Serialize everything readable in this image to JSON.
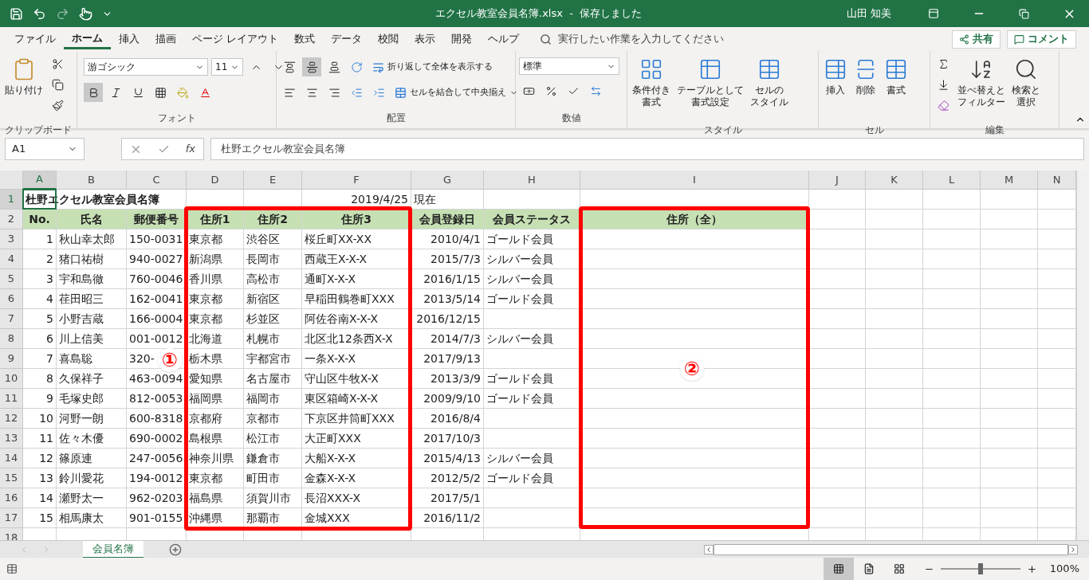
{
  "window": {
    "title": "エクセル教室会員名簿.xlsx  -  保存しました",
    "user": "山田 知美"
  },
  "tabs": [
    {
      "label": "ファイル",
      "selected": false
    },
    {
      "label": "ホーム",
      "selected": true
    },
    {
      "label": "挿入",
      "selected": false
    },
    {
      "label": "描画",
      "selected": false
    },
    {
      "label": "ページ レイアウト",
      "selected": false
    },
    {
      "label": "数式",
      "selected": false
    },
    {
      "label": "データ",
      "selected": false
    },
    {
      "label": "校閲",
      "selected": false
    },
    {
      "label": "表示",
      "selected": false
    },
    {
      "label": "開発",
      "selected": false
    },
    {
      "label": "ヘルプ",
      "selected": false
    }
  ],
  "tell_me": {
    "placeholder": "実行したい作業を入力してください"
  },
  "share_button": "共有",
  "comment_button": "コメント",
  "ribbon": {
    "clipboard": {
      "label": "クリップボード",
      "paste": "貼り付け"
    },
    "font": {
      "label": "フォント",
      "font_name": "游ゴシック",
      "font_size": "11",
      "bold": true
    },
    "alignment": {
      "label": "配置",
      "wrap": "折り返して全体を表示する",
      "merge": "セルを結合して中央揃え",
      "middle_align": true
    },
    "number": {
      "label": "数値",
      "format": "標準"
    },
    "styles": {
      "label": "スタイル",
      "buttons": [
        {
          "lines": [
            "条件付き",
            "書式"
          ]
        },
        {
          "lines": [
            "テーブルとして",
            "書式設定"
          ]
        },
        {
          "lines": [
            "セルの",
            "スタイル"
          ]
        }
      ]
    },
    "cells": {
      "label": "セル",
      "buttons": [
        "挿入",
        "削除",
        "書式"
      ]
    },
    "editing": {
      "label": "編集",
      "buttons": [
        {
          "lines": [
            "並べ替えと",
            "フィルター"
          ]
        },
        {
          "lines": [
            "検索と",
            "選択"
          ]
        }
      ]
    }
  },
  "formula_bar": {
    "name_box": "A1",
    "fx": "fx",
    "formula": "杜野エクセル教室会員名簿"
  },
  "sheet": {
    "columns": [
      {
        "label": "A",
        "selected": true
      },
      {
        "label": "B",
        "selected": false
      },
      {
        "label": "C",
        "selected": false
      },
      {
        "label": "D",
        "selected": false
      },
      {
        "label": "E",
        "selected": false
      },
      {
        "label": "F",
        "selected": false
      },
      {
        "label": "G",
        "selected": false
      },
      {
        "label": "H",
        "selected": false
      },
      {
        "label": "I",
        "selected": false
      },
      {
        "label": "J",
        "selected": false
      },
      {
        "label": "K",
        "selected": false
      },
      {
        "label": "L",
        "selected": false
      },
      {
        "label": "M",
        "selected": false
      },
      {
        "label": "N",
        "selected": false
      }
    ],
    "rows": [
      {
        "number": "1",
        "selected": true,
        "kind": "title",
        "cells": [
          {
            "text": "杜野エクセル教室会員名簿"
          },
          null,
          null,
          null,
          null,
          {
            "text": "2019/4/25",
            "right": true
          },
          {
            "text": "現在"
          },
          null,
          null
        ]
      },
      {
        "number": "2",
        "selected": false,
        "kind": "header",
        "cells": [
          {
            "text": "No."
          },
          {
            "text": "氏名"
          },
          {
            "text": "郵便番号"
          },
          {
            "text": "住所1"
          },
          {
            "text": "住所2"
          },
          {
            "text": "住所3"
          },
          {
            "text": "会員登録日"
          },
          {
            "text": "会員ステータス"
          },
          {
            "text": "住所（全）"
          }
        ]
      },
      {
        "number": "3",
        "selected": false,
        "kind": "data",
        "cells": [
          {
            "text": "1",
            "right": true
          },
          {
            "text": "秋山幸太郎"
          },
          {
            "text": "150-0031"
          },
          {
            "text": "東京都"
          },
          {
            "text": "渋谷区"
          },
          {
            "text": "桜丘町XX-XX"
          },
          {
            "text": "2010/4/1",
            "right": true
          },
          {
            "text": "ゴールド会員"
          },
          null
        ]
      },
      {
        "number": "4",
        "selected": false,
        "kind": "data",
        "cells": [
          {
            "text": "2",
            "right": true
          },
          {
            "text": "猪口祐樹"
          },
          {
            "text": "940-0027"
          },
          {
            "text": "新潟県"
          },
          {
            "text": "長岡市"
          },
          {
            "text": "西蔵王X-X-X"
          },
          {
            "text": "2015/7/3",
            "right": true
          },
          {
            "text": "シルバー会員"
          },
          null
        ]
      },
      {
        "number": "5",
        "selected": false,
        "kind": "data",
        "cells": [
          {
            "text": "3",
            "right": true
          },
          {
            "text": "宇和島徹"
          },
          {
            "text": "760-0046"
          },
          {
            "text": "香川県"
          },
          {
            "text": "高松市"
          },
          {
            "text": "通町X-X-X"
          },
          {
            "text": "2016/1/15",
            "right": true
          },
          {
            "text": "シルバー会員"
          },
          null
        ]
      },
      {
        "number": "6",
        "selected": false,
        "kind": "data",
        "cells": [
          {
            "text": "4",
            "right": true
          },
          {
            "text": "荏田昭三"
          },
          {
            "text": "162-0041"
          },
          {
            "text": "東京都"
          },
          {
            "text": "新宿区"
          },
          {
            "text": "早稲田鶴巻町XXX"
          },
          {
            "text": "2013/5/14",
            "right": true
          },
          {
            "text": "ゴールド会員"
          },
          null
        ]
      },
      {
        "number": "7",
        "selected": false,
        "kind": "data",
        "cells": [
          {
            "text": "5",
            "right": true
          },
          {
            "text": "小野吉蔵"
          },
          {
            "text": "166-0004"
          },
          {
            "text": "東京都"
          },
          {
            "text": "杉並区"
          },
          {
            "text": "阿佐谷南X-X-X"
          },
          {
            "text": "2016/12/15",
            "right": true
          },
          null,
          null
        ]
      },
      {
        "number": "8",
        "selected": false,
        "kind": "data",
        "cells": [
          {
            "text": "6",
            "right": true
          },
          {
            "text": "川上信美"
          },
          {
            "text": "001-0012"
          },
          {
            "text": "北海道"
          },
          {
            "text": "札幌市"
          },
          {
            "text": "北区北12条西X-X"
          },
          {
            "text": "2014/7/3",
            "right": true
          },
          {
            "text": "シルバー会員"
          },
          null
        ]
      },
      {
        "number": "9",
        "selected": false,
        "kind": "data",
        "cells": [
          {
            "text": "7",
            "right": true
          },
          {
            "text": "喜島聡"
          },
          {
            "text": "320-"
          },
          {
            "text": "栃木県"
          },
          {
            "text": "宇都宮市"
          },
          {
            "text": "一条X-X-X"
          },
          {
            "text": "2017/9/13",
            "right": true
          },
          null,
          null
        ]
      },
      {
        "number": "10",
        "selected": false,
        "kind": "data",
        "cells": [
          {
            "text": "8",
            "right": true
          },
          {
            "text": "久保祥子"
          },
          {
            "text": "463-0094"
          },
          {
            "text": "愛知県"
          },
          {
            "text": "名古屋市"
          },
          {
            "text": "守山区牛牧X-X"
          },
          {
            "text": "2013/3/9",
            "right": true
          },
          {
            "text": "ゴールド会員"
          },
          null
        ]
      },
      {
        "number": "11",
        "selected": false,
        "kind": "data",
        "cells": [
          {
            "text": "9",
            "right": true
          },
          {
            "text": "毛塚史郎"
          },
          {
            "text": "812-0053"
          },
          {
            "text": "福岡県"
          },
          {
            "text": "福岡市"
          },
          {
            "text": "東区箱崎X-X-X"
          },
          {
            "text": "2009/9/10",
            "right": true
          },
          {
            "text": "ゴールド会員"
          },
          null
        ]
      },
      {
        "number": "12",
        "selected": false,
        "kind": "data",
        "cells": [
          {
            "text": "10",
            "right": true
          },
          {
            "text": "河野一朗"
          },
          {
            "text": "600-8318"
          },
          {
            "text": "京都府"
          },
          {
            "text": "京都市"
          },
          {
            "text": "下京区井筒町XXX"
          },
          {
            "text": "2016/8/4",
            "right": true
          },
          null,
          null
        ]
      },
      {
        "number": "13",
        "selected": false,
        "kind": "data",
        "cells": [
          {
            "text": "11",
            "right": true
          },
          {
            "text": "佐々木優"
          },
          {
            "text": "690-0002"
          },
          {
            "text": "島根県"
          },
          {
            "text": "松江市"
          },
          {
            "text": "大正町XXX"
          },
          {
            "text": "2017/10/3",
            "right": true
          },
          null,
          null
        ]
      },
      {
        "number": "14",
        "selected": false,
        "kind": "data",
        "cells": [
          {
            "text": "12",
            "right": true
          },
          {
            "text": "篠原連"
          },
          {
            "text": "247-0056"
          },
          {
            "text": "神奈川県"
          },
          {
            "text": "鎌倉市"
          },
          {
            "text": "大船X-X-X"
          },
          {
            "text": "2015/4/13",
            "right": true
          },
          {
            "text": "シルバー会員"
          },
          null
        ]
      },
      {
        "number": "15",
        "selected": false,
        "kind": "data",
        "cells": [
          {
            "text": "13",
            "right": true
          },
          {
            "text": "鈴川愛花"
          },
          {
            "text": "194-0012"
          },
          {
            "text": "東京都"
          },
          {
            "text": "町田市"
          },
          {
            "text": "金森X-X-X"
          },
          {
            "text": "2012/5/2",
            "right": true
          },
          {
            "text": "ゴールド会員"
          },
          null
        ]
      },
      {
        "number": "16",
        "selected": false,
        "kind": "data",
        "cells": [
          {
            "text": "14",
            "right": true
          },
          {
            "text": "瀬野太一"
          },
          {
            "text": "962-0203"
          },
          {
            "text": "福島県"
          },
          {
            "text": "須賀川市"
          },
          {
            "text": "長沼XXX-X"
          },
          {
            "text": "2017/5/1",
            "right": true
          },
          null,
          null
        ]
      },
      {
        "number": "17",
        "selected": false,
        "kind": "data",
        "cells": [
          {
            "text": "15",
            "right": true
          },
          {
            "text": "相馬康太"
          },
          {
            "text": "901-0155"
          },
          {
            "text": "沖縄県"
          },
          {
            "text": "那覇市"
          },
          {
            "text": "金城XXX"
          },
          {
            "text": "2016/11/2",
            "right": true
          },
          null,
          null
        ]
      },
      {
        "number": "18",
        "selected": false,
        "kind": "data",
        "cells": []
      }
    ]
  },
  "annotations": [
    {
      "label": "①"
    },
    {
      "label": "②"
    }
  ],
  "sheet_tabs": [
    {
      "label": "会員名簿",
      "selected": true
    }
  ],
  "status_bar": {
    "views": [
      {
        "selected": true
      },
      {
        "selected": false
      },
      {
        "selected": false
      }
    ],
    "zoom": {
      "level": 0.5,
      "reading": "100%"
    }
  }
}
